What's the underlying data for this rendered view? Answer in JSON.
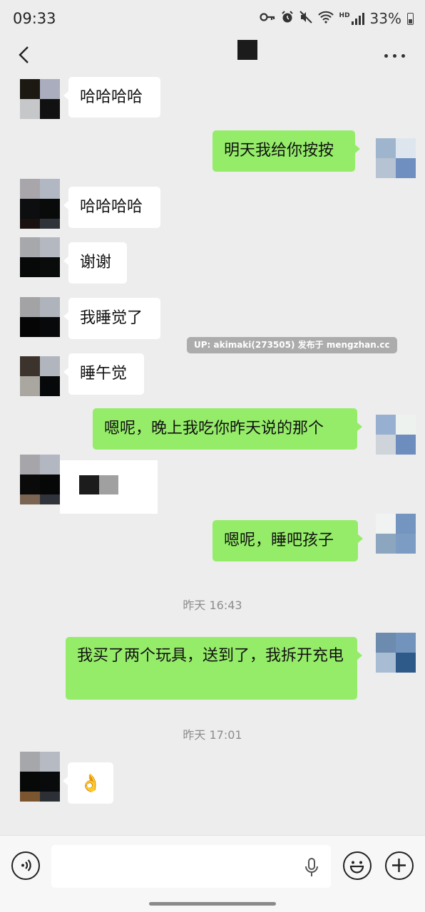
{
  "status_bar": {
    "time": "09:33",
    "hd_label": "HD",
    "battery": "33%",
    "icons": [
      "key-icon",
      "alarm-icon",
      "mute-icon",
      "wifi-icon",
      "signal-icon",
      "battery-icon"
    ]
  },
  "nav": {
    "back_icon": "chevron-left-icon",
    "more_icon": "more-dots-icon"
  },
  "messages": [
    {
      "side": "in",
      "text": "哈哈哈哈"
    },
    {
      "side": "out",
      "text": "明天我给你按按"
    },
    {
      "side": "in",
      "text": "哈哈哈哈"
    },
    {
      "side": "in",
      "text": "谢谢"
    },
    {
      "side": "in",
      "text": "我睡觉了"
    },
    {
      "side": "in",
      "text": "睡午觉"
    },
    {
      "side": "out",
      "text": "嗯呢，晚上我吃你昨天说的那个"
    },
    {
      "side": "in",
      "text": "",
      "type": "censored-image"
    },
    {
      "side": "out",
      "text": "嗯呢，睡吧孩子"
    },
    {
      "side": "out",
      "text": "我买了两个玩具，送到了，我拆开充电"
    },
    {
      "side": "in",
      "text": "👌",
      "type": "emoji"
    }
  ],
  "timestamps": [
    "昨天 16:43",
    "昨天 17:01"
  ],
  "watermark": "UP: akimaki(273505) 发布于 mengzhan.cc",
  "input_bar": {
    "voice_icon": "voice-icon",
    "mic_icon": "microphone-icon",
    "emoji_icon": "emoji-icon",
    "plus_icon": "plus-icon",
    "placeholder": ""
  }
}
